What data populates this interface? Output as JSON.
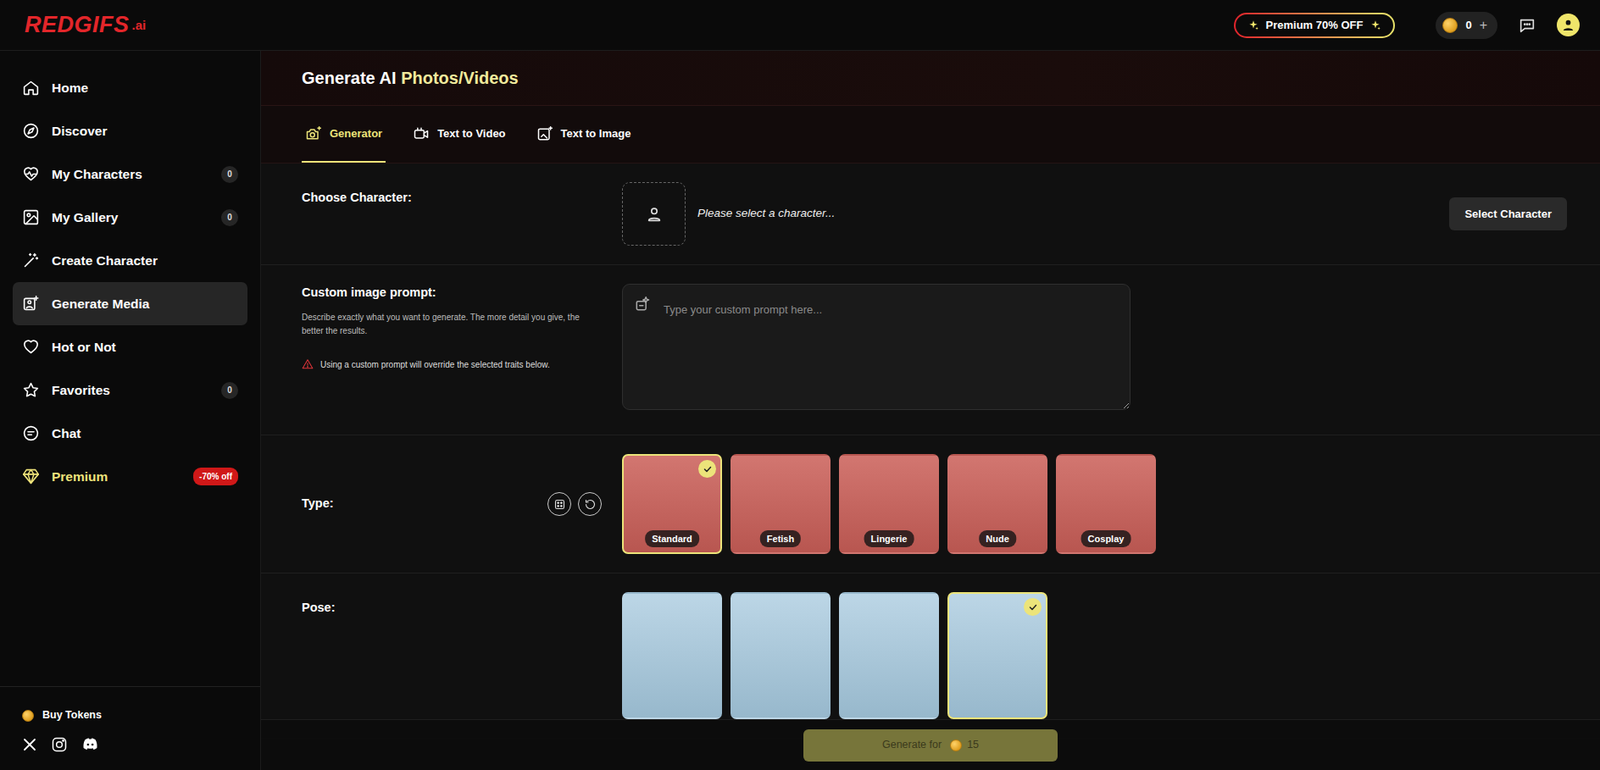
{
  "header": {
    "logo": "REDGIFS",
    "logo_suffix": ".ai",
    "premium": "Premium 70% OFF",
    "tokens": "0",
    "add_tokens": "+"
  },
  "sidebar": {
    "items": [
      {
        "label": "Home",
        "selected": false
      },
      {
        "label": "Discover",
        "selected": false
      },
      {
        "label": "My Characters",
        "badge": "0",
        "selected": false
      },
      {
        "label": "My Gallery",
        "badge": "0",
        "selected": false
      },
      {
        "label": "Create Character",
        "selected": false
      },
      {
        "label": "Generate Media",
        "selected": true
      },
      {
        "label": "Hot or Not",
        "selected": false
      },
      {
        "label": "Favorites",
        "badge": "0",
        "selected": false
      },
      {
        "label": "Chat",
        "selected": false
      }
    ],
    "premium": {
      "label": "Premium",
      "badge": "-70% off"
    },
    "buy_tokens": "Buy Tokens"
  },
  "page": {
    "title": "Generate AI",
    "title_accent": "Photos/Videos"
  },
  "tabs": [
    {
      "label": "Generator",
      "selected": true
    },
    {
      "label": "Text to Video",
      "selected": false
    },
    {
      "label": "Text to Image",
      "selected": false
    }
  ],
  "character": {
    "label": "Choose Character:",
    "placeholder": "Please select a character...",
    "button": "Select Character"
  },
  "prompt": {
    "label": "Custom image prompt:",
    "help": "Describe exactly what you want to generate. The more detail you give, the better the results.",
    "warning": "Using a custom prompt will override the selected traits below.",
    "placeholder": "Type your custom prompt here..."
  },
  "type": {
    "label": "Type:",
    "options": [
      {
        "label": "Standard",
        "selected": true
      },
      {
        "label": "Fetish",
        "selected": false
      },
      {
        "label": "Lingerie",
        "selected": false
      },
      {
        "label": "Nude",
        "selected": false
      },
      {
        "label": "Cosplay",
        "selected": false
      }
    ]
  },
  "pose": {
    "label": "Pose:",
    "options": [
      {
        "selected": false
      },
      {
        "selected": false
      },
      {
        "selected": false
      },
      {
        "selected": true
      }
    ]
  },
  "generate": {
    "label": "Generate for",
    "cost": "15"
  }
}
